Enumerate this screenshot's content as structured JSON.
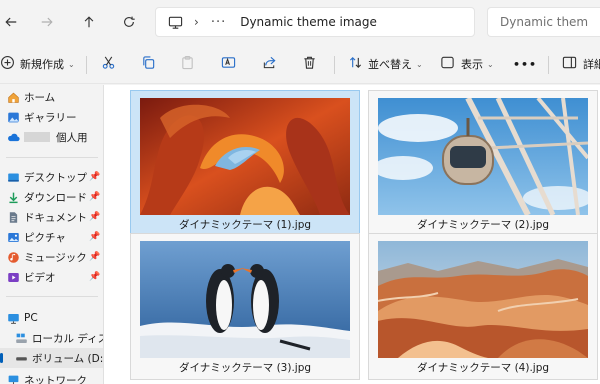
{
  "address_bar": {
    "path_label": "Dynamic theme image",
    "search_placeholder": "Dynamic them"
  },
  "toolbar": {
    "new_label": "新規作成",
    "sort_label": "並べ替え",
    "view_label": "表示",
    "more_label": "•••",
    "details_label": "詳細"
  },
  "sidebar": {
    "home": "ホーム",
    "gallery": "ギャラリー",
    "onedrive": "個人用",
    "desktop": "デスクトップ",
    "downloads": "ダウンロード",
    "documents": "ドキュメント",
    "pictures": "ピクチャ",
    "music": "ミュージック",
    "videos": "ビデオ",
    "pc": "PC",
    "local_disk": "ローカル ディスク (C",
    "volume_d": "ボリューム (D:)",
    "network": "ネットワーク"
  },
  "files": [
    {
      "name": "ダイナミックテーマ (1).jpg",
      "thumb": "antelope-canyon"
    },
    {
      "name": "ダイナミックテーマ (2).jpg",
      "thumb": "ferris-wheel"
    },
    {
      "name": "ダイナミックテーマ (3).jpg",
      "thumb": "penguins"
    },
    {
      "name": "ダイナミックテーマ (4).jpg",
      "thumb": "rainbow-mountains"
    }
  ],
  "colors": {
    "accent": "#005fb8",
    "selected_tile": "#cce4f7",
    "selected_tile_border": "#99c9ef"
  }
}
